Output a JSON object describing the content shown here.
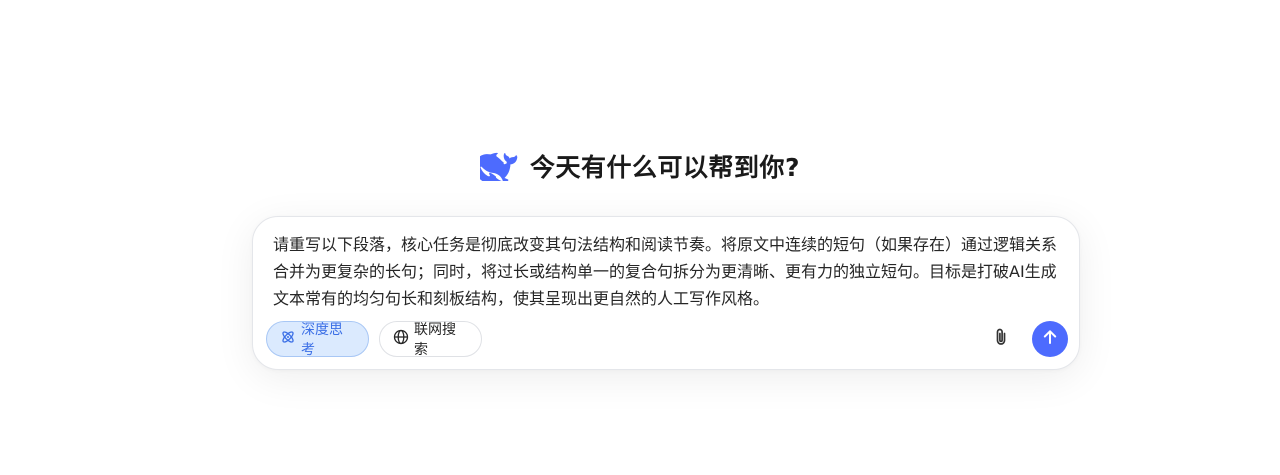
{
  "greeting": {
    "logo_icon": "deepseek-whale-logo",
    "title": "今天有什么可以帮到你?"
  },
  "composer": {
    "input_value": "请重写以下段落，核心任务是彻底改变其句法结构和阅读节奏。将原文中连续的短句（如果存在）通过逻辑关系合并为更复杂的长句；同时，将过长或结构单一的复合句拆分为更清晰、更有力的独立短句。目标是打破AI生成文本常有的均匀句长和刻板结构，使其呈现出更自然的人工写作风格。",
    "deep_think": {
      "label": "深度思考",
      "icon": "atom-icon",
      "active": true
    },
    "web_search": {
      "label": "联网搜索",
      "icon": "globe-icon",
      "active": false
    },
    "attach_icon": "paperclip-icon",
    "send_icon": "arrow-up-icon"
  },
  "colors": {
    "accent": "#4d6bfe",
    "pill_active_bg": "#dbeafe",
    "pill_active_text": "#3b6fe6"
  }
}
